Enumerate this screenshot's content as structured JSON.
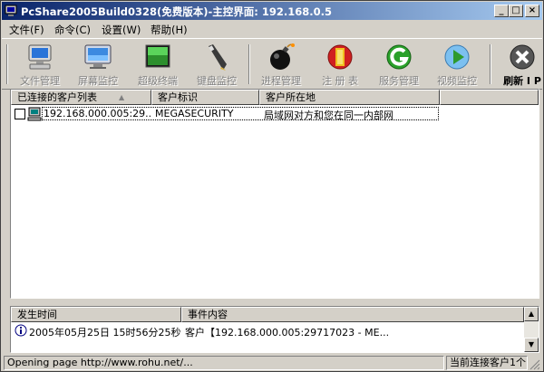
{
  "window": {
    "title": "PcShare2005Build0328(免费版本)-主控界面: 192.168.0.5",
    "controls": {
      "minimize": "_",
      "maximize": "□",
      "close": "×"
    }
  },
  "menu": [
    {
      "label": "文件(F)"
    },
    {
      "label": "命令(C)"
    },
    {
      "label": "设置(W)"
    },
    {
      "label": "帮助(H)"
    }
  ],
  "toolbar": [
    {
      "label": "文件管理",
      "icon": "computer-icon"
    },
    {
      "label": "屏幕监控",
      "icon": "monitor-icon"
    },
    {
      "label": "超级终端",
      "icon": "terminal-icon"
    },
    {
      "label": "键盘监控",
      "icon": "pen-icon"
    },
    {
      "label": "进程管理",
      "icon": "bomb-icon"
    },
    {
      "label": "注 册 表",
      "icon": "registry-icon"
    },
    {
      "label": "服务管理",
      "icon": "service-icon"
    },
    {
      "label": "视频监控",
      "icon": "play-icon"
    },
    {
      "label": "刷新 I P",
      "icon": "refresh-x-icon"
    }
  ],
  "clients": {
    "columns": [
      "已连接的客户列表",
      "客户标识",
      "客户所在地"
    ],
    "rows": [
      {
        "address": "192.168.000.005:29...",
        "id": "MEGASECURITY",
        "location": "局域网对方和您在同一内部网"
      }
    ]
  },
  "events": {
    "columns": [
      "发生时间",
      "事件内容"
    ],
    "rows": [
      {
        "time": "2005年05月25日 15时56分25秒",
        "content": "客户【192.168.000.005:29717023 - ME..."
      }
    ]
  },
  "status": {
    "left": "Opening page http://www.rohu.net/...",
    "right": "当前连接客户1个"
  },
  "colors": {
    "title_start": "#0a246a",
    "title_end": "#a6caf0",
    "face": "#d4d0c8"
  }
}
